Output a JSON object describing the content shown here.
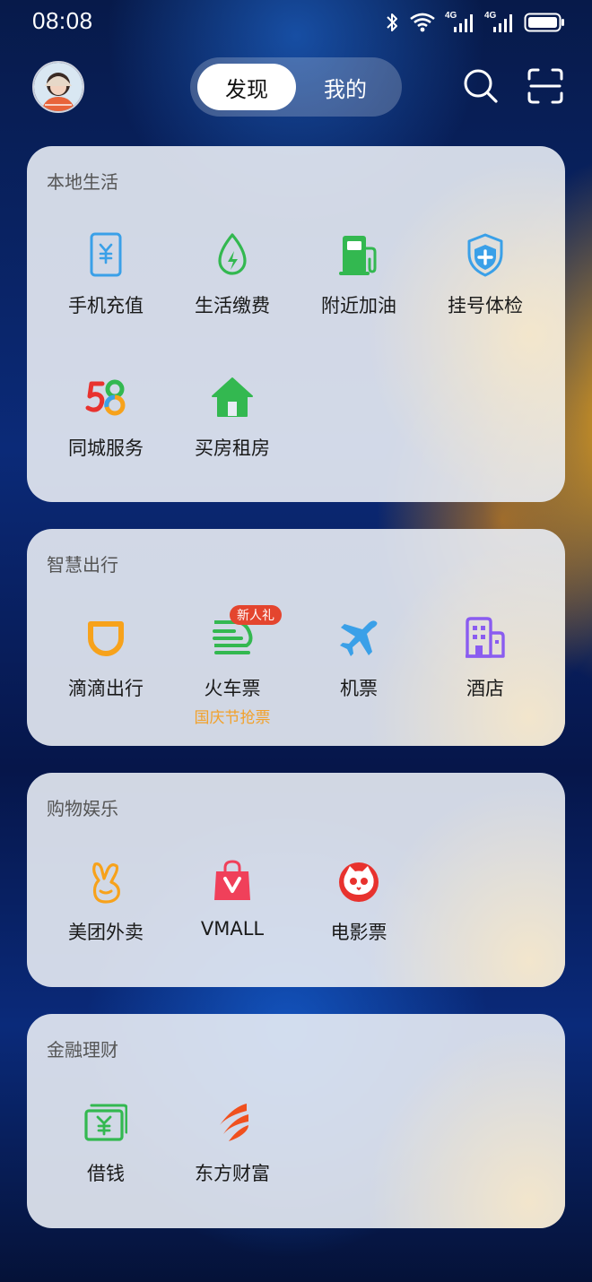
{
  "status_bar": {
    "time": "08:08",
    "icons": [
      "bluetooth-icon",
      "wifi-icon",
      "signal-4g-icon",
      "signal-4g-icon",
      "battery-icon"
    ],
    "network_labels": [
      "4G",
      "4G"
    ]
  },
  "header": {
    "avatar": "avatar",
    "tabs": [
      {
        "label": "发现",
        "active": true
      },
      {
        "label": "我的",
        "active": false
      }
    ],
    "icons": [
      "search-icon",
      "scan-icon"
    ]
  },
  "sections": [
    {
      "title": "本地生活",
      "items": [
        {
          "label": "手机充值",
          "icon": "phone-recharge-icon",
          "color": "#3aa0e8"
        },
        {
          "label": "生活缴费",
          "icon": "utility-bill-icon",
          "color": "#33b850"
        },
        {
          "label": "附近加油",
          "icon": "gas-station-icon",
          "color": "#33b850"
        },
        {
          "label": "挂号体检",
          "icon": "medical-shield-icon",
          "color": "#3aa0e8"
        },
        {
          "label": "同城服务",
          "icon": "58-logo-icon",
          "logo_text": "58"
        },
        {
          "label": "买房租房",
          "icon": "house-icon",
          "color": "#33b850"
        }
      ]
    },
    {
      "title": "智慧出行",
      "items": [
        {
          "label": "滴滴出行",
          "icon": "didi-icon",
          "color": "#f7a21b"
        },
        {
          "label": "火车票",
          "icon": "train-icon",
          "color": "#33b850",
          "badge": "新人礼",
          "sub": "国庆节抢票"
        },
        {
          "label": "机票",
          "icon": "airplane-icon",
          "color": "#3aa0e8"
        },
        {
          "label": "酒店",
          "icon": "hotel-icon",
          "color": "#8a5cf0"
        }
      ]
    },
    {
      "title": "购物娱乐",
      "items": [
        {
          "label": "美团外卖",
          "icon": "meituan-rabbit-icon",
          "color": "#f7a21b"
        },
        {
          "label": "VMALL",
          "icon": "shopping-bag-icon",
          "color": "#f0405a"
        },
        {
          "label": "电影票",
          "icon": "cat-eye-icon",
          "color": "#e8322e"
        }
      ]
    },
    {
      "title": "金融理财",
      "items": [
        {
          "label": "借钱",
          "icon": "cash-icon",
          "color": "#33b850"
        },
        {
          "label": "东方财富",
          "icon": "eastmoney-icon",
          "color": "#f0501e"
        }
      ]
    }
  ]
}
